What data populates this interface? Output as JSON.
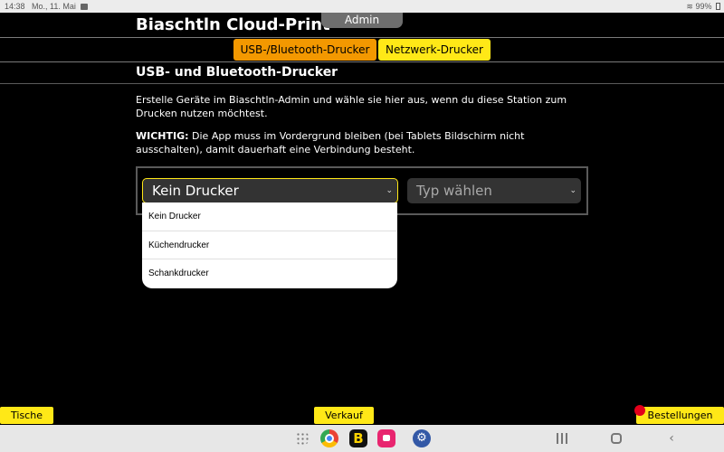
{
  "status_bar": {
    "time": "14:38",
    "date": "Mo., 11. Mai",
    "battery": "99%"
  },
  "header": {
    "title": "Biaschtln Cloud-Print",
    "admin_tab": "Admin"
  },
  "tabs": [
    {
      "label": "USB-/Bluetooth-Drucker",
      "active": true,
      "color": "#f39800"
    },
    {
      "label": "Netzwerk-Drucker",
      "active": false,
      "color": "#ffe817"
    }
  ],
  "section": {
    "title": "USB- und Bluetooth-Drucker",
    "intro": "Erstelle Geräte im Biaschtln-Admin und wähle sie hier aus, wenn du diese Station zum Drucken nutzen möchtest.",
    "warning_label": "WICHTIG:",
    "warning_text": " Die App muss im Vordergrund bleiben (bei Tablets Bildschirm nicht ausschalten), damit dauerhaft eine Verbindung besteht."
  },
  "device": {
    "printer_select": {
      "value": "Kein Drucker"
    },
    "type_select": {
      "placeholder": "Typ wählen"
    },
    "dropdown_options": [
      "Kein Drucker",
      "Küchendrucker",
      "Schankdrucker"
    ]
  },
  "bottom_nav": {
    "left": "Tische",
    "center": "Verkauf",
    "right": "Bestellungen"
  },
  "colors": {
    "accent_yellow": "#ffe817",
    "accent_orange": "#f39800",
    "notification": "#e3001b"
  }
}
